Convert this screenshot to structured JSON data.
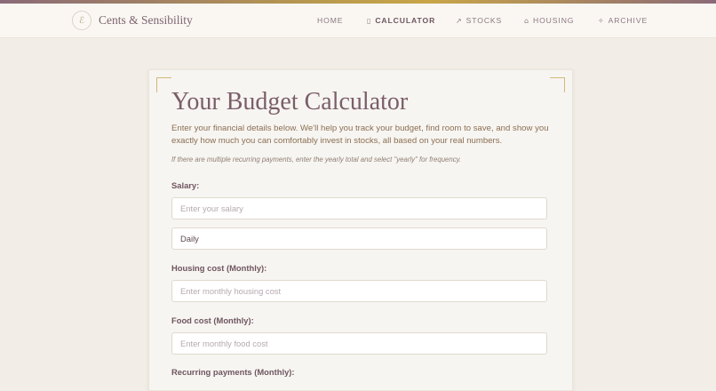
{
  "brand": {
    "logo_glyph": "ℰ",
    "name": "Cents & Sensibility"
  },
  "nav": [
    {
      "label": "HOME",
      "icon": "",
      "active": false
    },
    {
      "label": "CALCULATOR",
      "icon": "calculator-icon",
      "active": true
    },
    {
      "label": "STOCKS",
      "icon": "trend-up-icon",
      "active": false
    },
    {
      "label": "HOUSING",
      "icon": "house-icon",
      "active": false
    },
    {
      "label": "ARCHIVE",
      "icon": "sparkle-icon",
      "active": false
    }
  ],
  "main": {
    "title": "Your Budget Calculator",
    "intro": "Enter your financial details below. We'll help you track your budget, find room to save, and show you exactly how much you can comfortably invest in stocks, all based on your real numbers.",
    "note": "If there are multiple recurring payments, enter the yearly total and select \"yearly\" for frequency.",
    "salary": {
      "label": "Salary:",
      "placeholder": "Enter your salary",
      "frequency": "Daily"
    },
    "housing": {
      "label": "Housing cost (Monthly):",
      "placeholder": "Enter monthly housing cost"
    },
    "food": {
      "label": "Food cost (Monthly):",
      "placeholder": "Enter monthly food cost"
    },
    "recurring": {
      "label": "Recurring payments (Monthly):"
    }
  },
  "colors": {
    "accent": "#7a5e6a",
    "gold": "#d3b77a",
    "background": "#f2ede7"
  }
}
